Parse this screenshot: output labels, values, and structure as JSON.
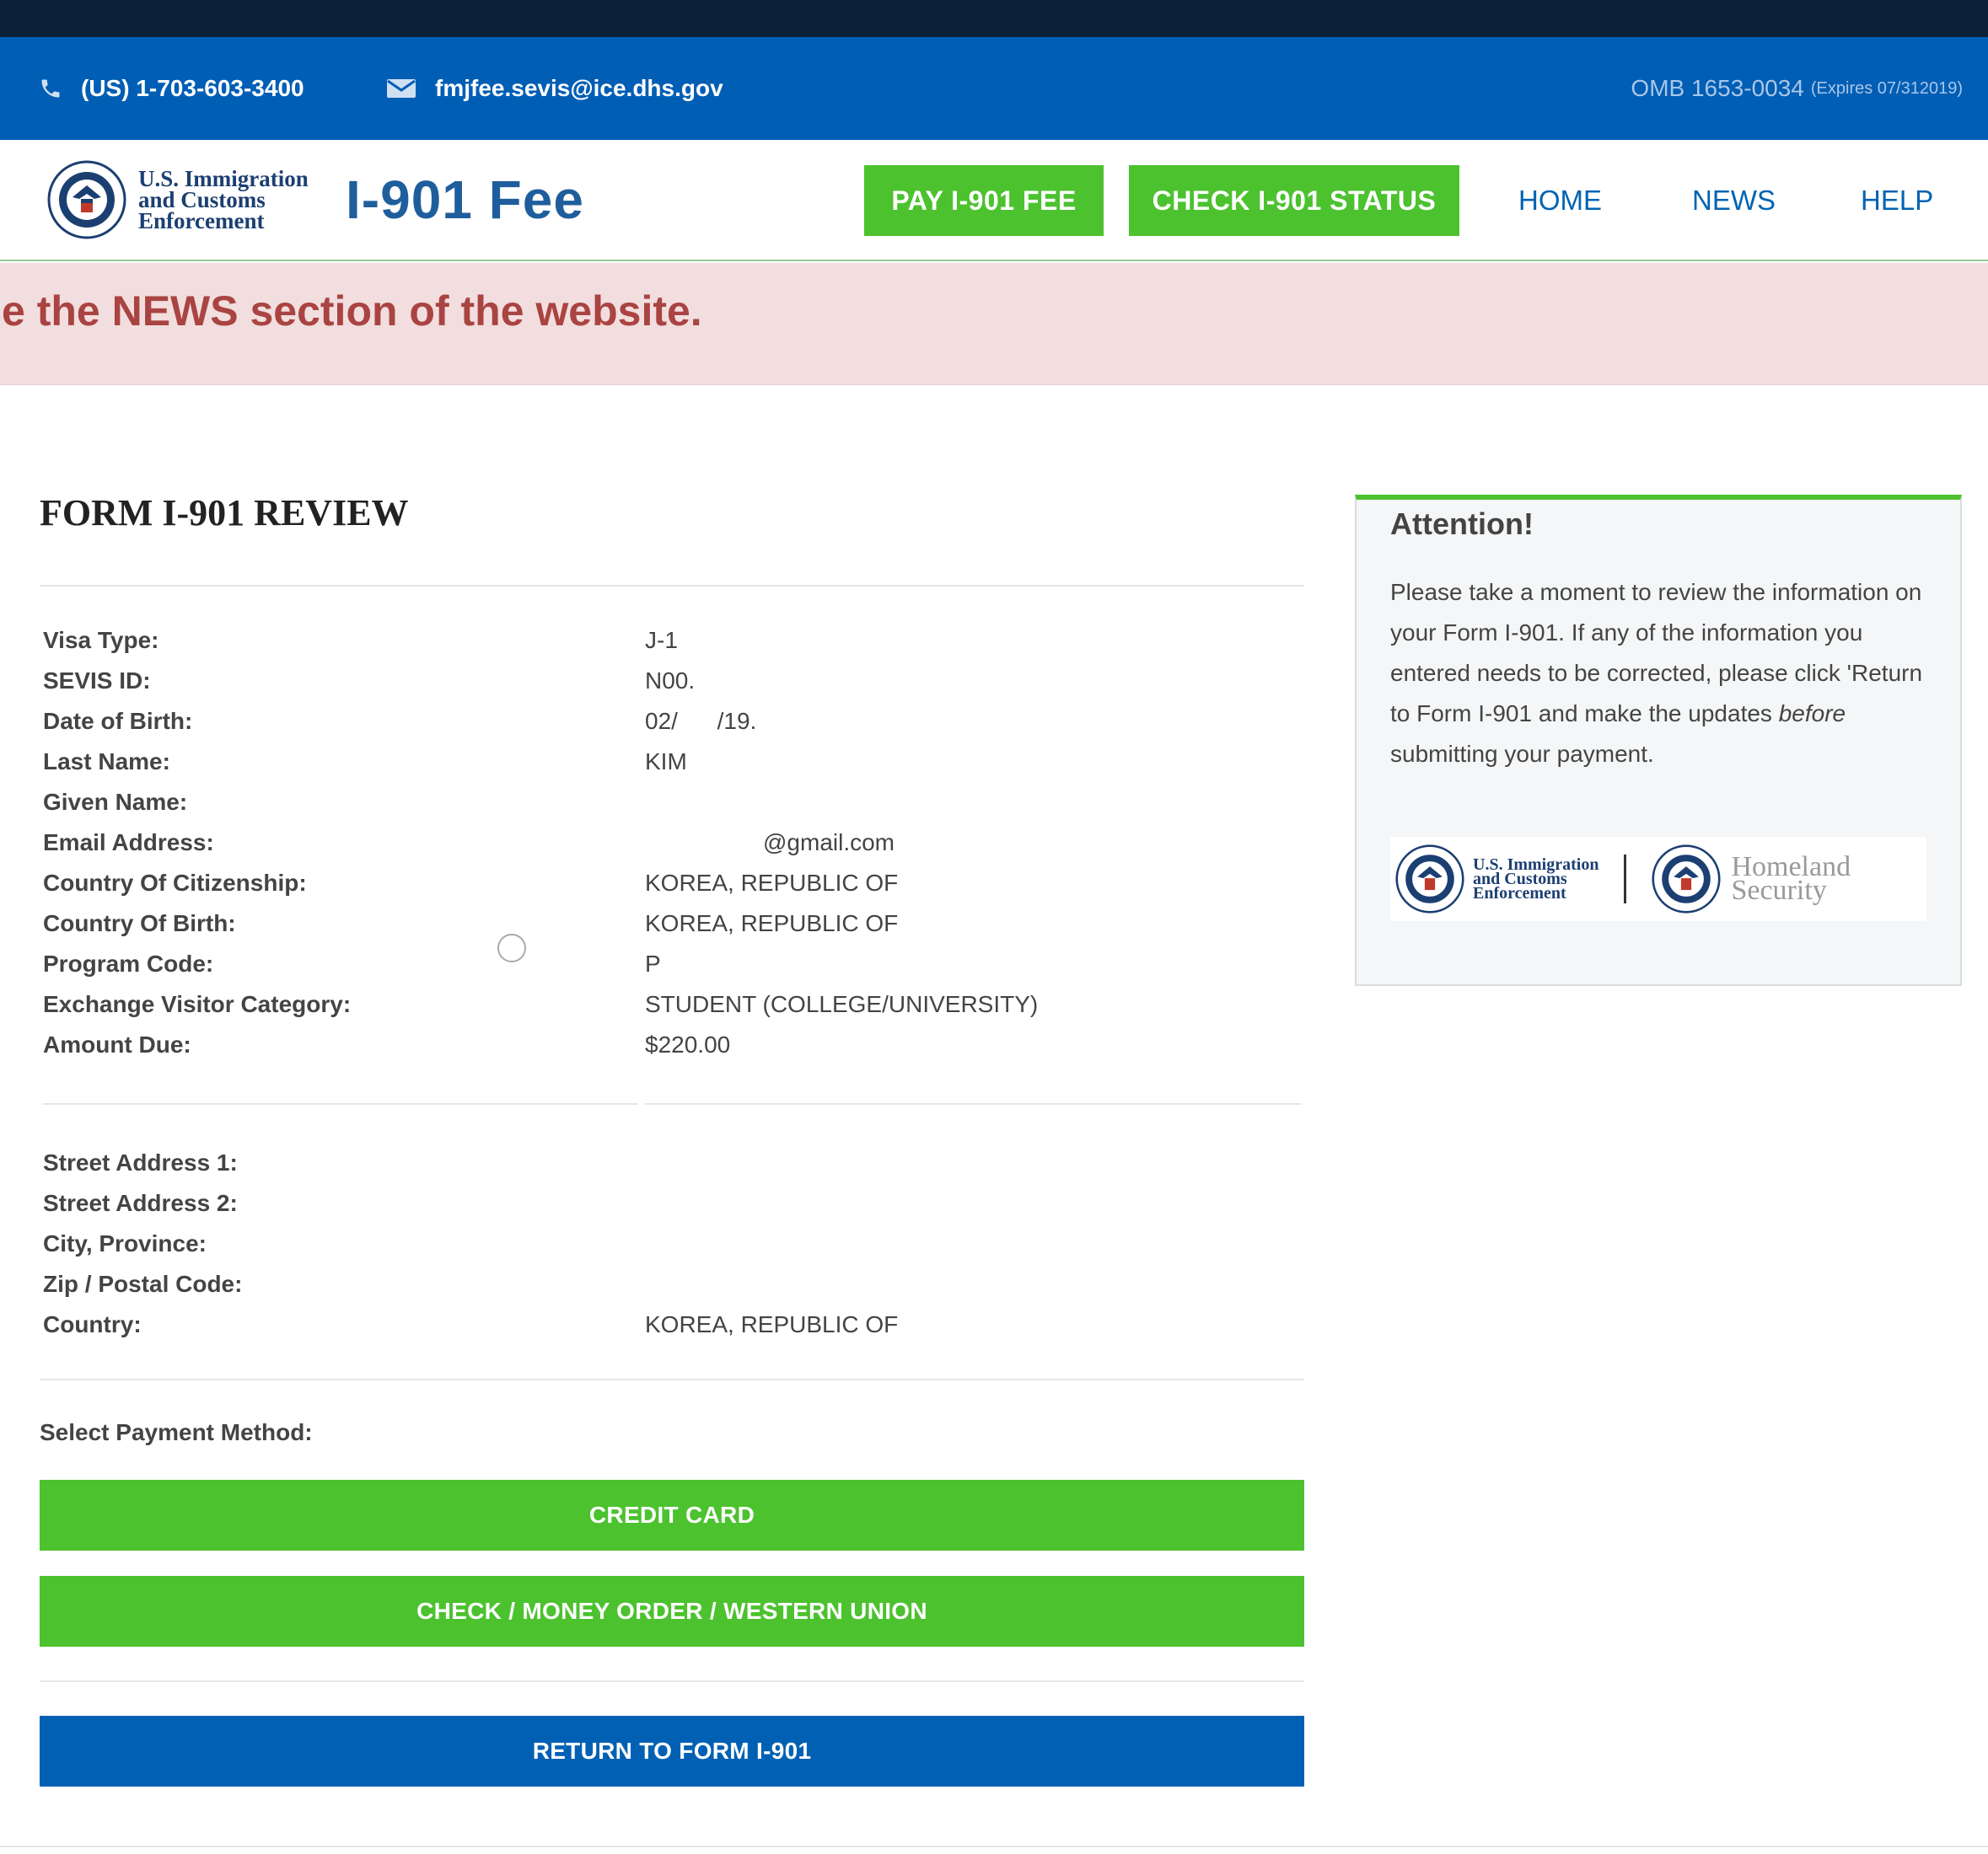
{
  "contact": {
    "phone": "(US) 1-703-603-3400",
    "email": "fmjfee.sevis@ice.dhs.gov",
    "omb": "OMB 1653-0034",
    "omb_expires": "(Expires 07/312019)"
  },
  "header": {
    "logo_text": [
      "U.S. Immigration",
      "and Customs",
      "Enforcement"
    ],
    "title": "I-901 Fee",
    "buttons": {
      "pay": "PAY I-901 FEE",
      "check": "CHECK I-901 STATUS"
    },
    "links": {
      "home": "HOME",
      "news": "NEWS",
      "help": "HELP"
    }
  },
  "alert": {
    "text": "e the NEWS section of the website."
  },
  "form": {
    "title": "FORM I-901 REVIEW",
    "fields": [
      {
        "label": "Visa Type:",
        "value": "J-1"
      },
      {
        "label": "SEVIS ID:",
        "value": "N00."
      },
      {
        "label": "Date of Birth:",
        "value": "02/      /19."
      },
      {
        "label": "Last Name:",
        "value": "KIM"
      },
      {
        "label": "Given Name:",
        "value": ""
      },
      {
        "label": "Email Address:",
        "value": "@gmail.com"
      },
      {
        "label": "Country Of Citizenship:",
        "value": "KOREA, REPUBLIC OF"
      },
      {
        "label": "Country Of Birth:",
        "value": "KOREA, REPUBLIC OF"
      },
      {
        "label": "Program Code:",
        "value": "P"
      },
      {
        "label": "Exchange Visitor Category:",
        "value": "STUDENT (COLLEGE/UNIVERSITY)"
      },
      {
        "label": "Amount Due:",
        "value": "$220.00"
      }
    ],
    "address": [
      {
        "label": "Street Address 1:",
        "value": ""
      },
      {
        "label": "Street Address 2:",
        "value": ""
      },
      {
        "label": "City, Province:",
        "value": ""
      },
      {
        "label": "Zip / Postal Code:",
        "value": ""
      },
      {
        "label": "Country:",
        "value": "KOREA, REPUBLIC OF"
      }
    ],
    "payment_label": "Select Payment Method:",
    "credit_card": "CREDIT CARD",
    "check_money_order": "CHECK / MONEY ORDER / WESTERN UNION",
    "return": "RETURN TO FORM I-901"
  },
  "attention": {
    "title": "Attention!",
    "body_before": "Please take a moment to review the information on your Form I-901. If any of the information you entered needs to be corrected, please click 'Return to Form I-901 and make the updates ",
    "body_emph": "before",
    "body_after": " submitting your payment.",
    "logo_ice": [
      "U.S. Immigration",
      "and Customs",
      "Enforcement"
    ],
    "logo_dhs": [
      "Homeland",
      "Security"
    ]
  },
  "colors": {
    "green": "#4cc22f",
    "blue": "#005eb5",
    "alert_red": "#a94442"
  }
}
